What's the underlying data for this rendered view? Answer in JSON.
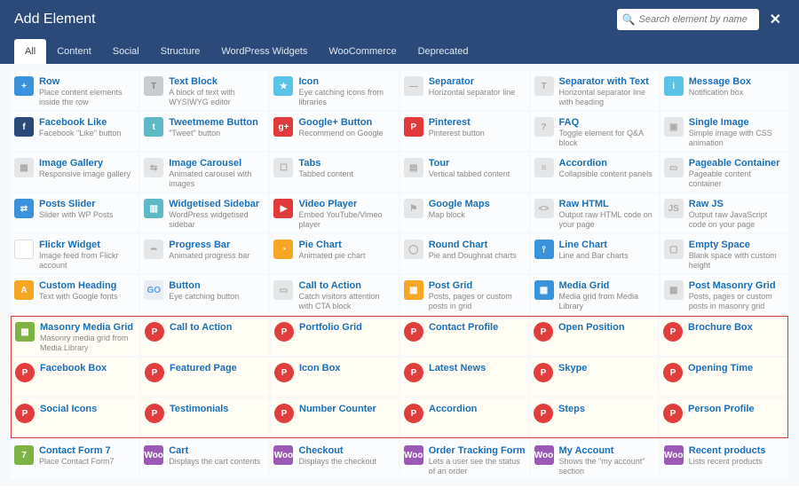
{
  "title": "Add Element",
  "search_placeholder": "Search element by name",
  "tabs": [
    "All",
    "Content",
    "Social",
    "Structure",
    "WordPress Widgets",
    "WooCommerce",
    "Deprecated"
  ],
  "active_tab": "All",
  "elements": [
    {
      "n": "Row",
      "d": "Place content elements inside the row",
      "ic": "i-blue",
      "t": "+"
    },
    {
      "n": "Text Block",
      "d": "A block of text with WYSIWYG editor",
      "ic": "i-gray",
      "t": "T"
    },
    {
      "n": "Icon",
      "d": "Eye catching icons from libraries",
      "ic": "i-cyan",
      "t": "★"
    },
    {
      "n": "Separator",
      "d": "Horizontal separator line",
      "ic": "i-grey",
      "t": "—"
    },
    {
      "n": "Separator with Text",
      "d": "Horizontal separator line with heading",
      "ic": "i-grey",
      "t": "T"
    },
    {
      "n": "Message Box",
      "d": "Notification box",
      "ic": "i-cyan",
      "t": "i"
    },
    {
      "n": "Facebook Like",
      "d": "Facebook \"Like\" button",
      "ic": "i-navy",
      "t": "f"
    },
    {
      "n": "Tweetmeme Button",
      "d": "\"Tweet\" button",
      "ic": "i-teal",
      "t": "t"
    },
    {
      "n": "Google+ Button",
      "d": "Recommend on Google",
      "ic": "i-red",
      "t": "g+"
    },
    {
      "n": "Pinterest",
      "d": "Pinterest button",
      "ic": "i-red",
      "t": "P"
    },
    {
      "n": "FAQ",
      "d": "Toggle element for Q&A block",
      "ic": "i-grey",
      "t": "?"
    },
    {
      "n": "Single Image",
      "d": "Simple image with CSS animation",
      "ic": "i-grey",
      "t": "▣"
    },
    {
      "n": "Image Gallery",
      "d": "Responsive image gallery",
      "ic": "i-grey",
      "t": "▦"
    },
    {
      "n": "Image Carousel",
      "d": "Animated carousel with images",
      "ic": "i-grey",
      "t": "⇆"
    },
    {
      "n": "Tabs",
      "d": "Tabbed content",
      "ic": "i-grey",
      "t": "☐"
    },
    {
      "n": "Tour",
      "d": "Vertical tabbed content",
      "ic": "i-grey",
      "t": "▤"
    },
    {
      "n": "Accordion",
      "d": "Collapsible content panels",
      "ic": "i-grey",
      "t": "≡"
    },
    {
      "n": "Pageable Container",
      "d": "Pageable content container",
      "ic": "i-grey",
      "t": "▭"
    },
    {
      "n": "Posts Slider",
      "d": "Slider with WP Posts",
      "ic": "i-blue",
      "t": "⇄"
    },
    {
      "n": "Widgetised Sidebar",
      "d": "WordPress widgetised sidebar",
      "ic": "i-teal",
      "t": "▥"
    },
    {
      "n": "Video Player",
      "d": "Embed YouTube/Vimeo player",
      "ic": "i-red",
      "t": "▶"
    },
    {
      "n": "Google Maps",
      "d": "Map block",
      "ic": "i-grey",
      "t": "⚑"
    },
    {
      "n": "Raw HTML",
      "d": "Output raw HTML code on your page",
      "ic": "i-grey",
      "t": "<>"
    },
    {
      "n": "Raw JS",
      "d": "Output raw JavaScript code on your page",
      "ic": "i-grey",
      "t": "JS"
    },
    {
      "n": "Flickr Widget",
      "d": "Image feed from Flickr account",
      "ic": "i-flickr",
      "t": "••"
    },
    {
      "n": "Progress Bar",
      "d": "Animated progress bar",
      "ic": "i-grey",
      "t": "━"
    },
    {
      "n": "Pie Chart",
      "d": "Animated pie chart",
      "ic": "i-orange",
      "t": "◔"
    },
    {
      "n": "Round Chart",
      "d": "Pie and Doughnat charts",
      "ic": "i-grey",
      "t": "◯"
    },
    {
      "n": "Line Chart",
      "d": "Line and Bar charts",
      "ic": "i-blue",
      "t": "⫯"
    },
    {
      "n": "Empty Space",
      "d": "Blank space with custom height",
      "ic": "i-grey",
      "t": "▢"
    },
    {
      "n": "Custom Heading",
      "d": "Text with Google fonts",
      "ic": "i-orange",
      "t": "A"
    },
    {
      "n": "Button",
      "d": "Eye catching button",
      "ic": "i-go",
      "t": "GO"
    },
    {
      "n": "Call to Action",
      "d": "Catch visitors attention with CTA block",
      "ic": "i-grey",
      "t": "▭"
    },
    {
      "n": "Post Grid",
      "d": "Posts, pages or custom posts in grid",
      "ic": "i-orange",
      "t": "▦"
    },
    {
      "n": "Media Grid",
      "d": "Media grid from Media Library",
      "ic": "i-blue",
      "t": "▦"
    },
    {
      "n": "Post Masonry Grid",
      "d": "Posts, pages or custom posts in masonry grid",
      "ic": "i-grey",
      "t": "▦"
    }
  ],
  "highlighted": [
    {
      "n": "Masonry Media Grid",
      "d": "Masonry media grid from Media Library",
      "ic": "i-green",
      "t": "▦"
    },
    {
      "n": "Call to Action",
      "d": "",
      "ic": "i-p",
      "t": "P"
    },
    {
      "n": "Portfolio Grid",
      "d": "",
      "ic": "i-p",
      "t": "P"
    },
    {
      "n": "Contact Profile",
      "d": "",
      "ic": "i-p",
      "t": "P"
    },
    {
      "n": "Open Position",
      "d": "",
      "ic": "i-p",
      "t": "P"
    },
    {
      "n": "Brochure Box",
      "d": "",
      "ic": "i-p",
      "t": "P"
    },
    {
      "n": "Facebook Box",
      "d": "",
      "ic": "i-p",
      "t": "P"
    },
    {
      "n": "Featured Page",
      "d": "",
      "ic": "i-p",
      "t": "P"
    },
    {
      "n": "Icon Box",
      "d": "",
      "ic": "i-p",
      "t": "P"
    },
    {
      "n": "Latest News",
      "d": "",
      "ic": "i-p",
      "t": "P"
    },
    {
      "n": "Skype",
      "d": "",
      "ic": "i-p",
      "t": "P"
    },
    {
      "n": "Opening Time",
      "d": "",
      "ic": "i-p",
      "t": "P"
    },
    {
      "n": "Social Icons",
      "d": "",
      "ic": "i-p",
      "t": "P"
    },
    {
      "n": "Testimonials",
      "d": "",
      "ic": "i-p",
      "t": "P"
    },
    {
      "n": "Number Counter",
      "d": "",
      "ic": "i-p",
      "t": "P"
    },
    {
      "n": "Accordion",
      "d": "",
      "ic": "i-p",
      "t": "P"
    },
    {
      "n": "Steps",
      "d": "",
      "ic": "i-p",
      "t": "P"
    },
    {
      "n": "Person Profile",
      "d": "",
      "ic": "i-p",
      "t": "P"
    }
  ],
  "bottom": [
    {
      "n": "Contact Form 7",
      "d": "Place Contact Form7",
      "ic": "i-green",
      "t": "7"
    },
    {
      "n": "Cart",
      "d": "Displays the cart contents",
      "ic": "i-purple",
      "t": "Woo"
    },
    {
      "n": "Checkout",
      "d": "Displays the checkout",
      "ic": "i-purple",
      "t": "Woo"
    },
    {
      "n": "Order Tracking Form",
      "d": "Lets a user see the status of an order",
      "ic": "i-purple",
      "t": "Woo"
    },
    {
      "n": "My Account",
      "d": "Shows the \"my account\" section",
      "ic": "i-purple",
      "t": "Woo"
    },
    {
      "n": "Recent products",
      "d": "Lists recent products",
      "ic": "i-purple",
      "t": "Woo"
    }
  ]
}
